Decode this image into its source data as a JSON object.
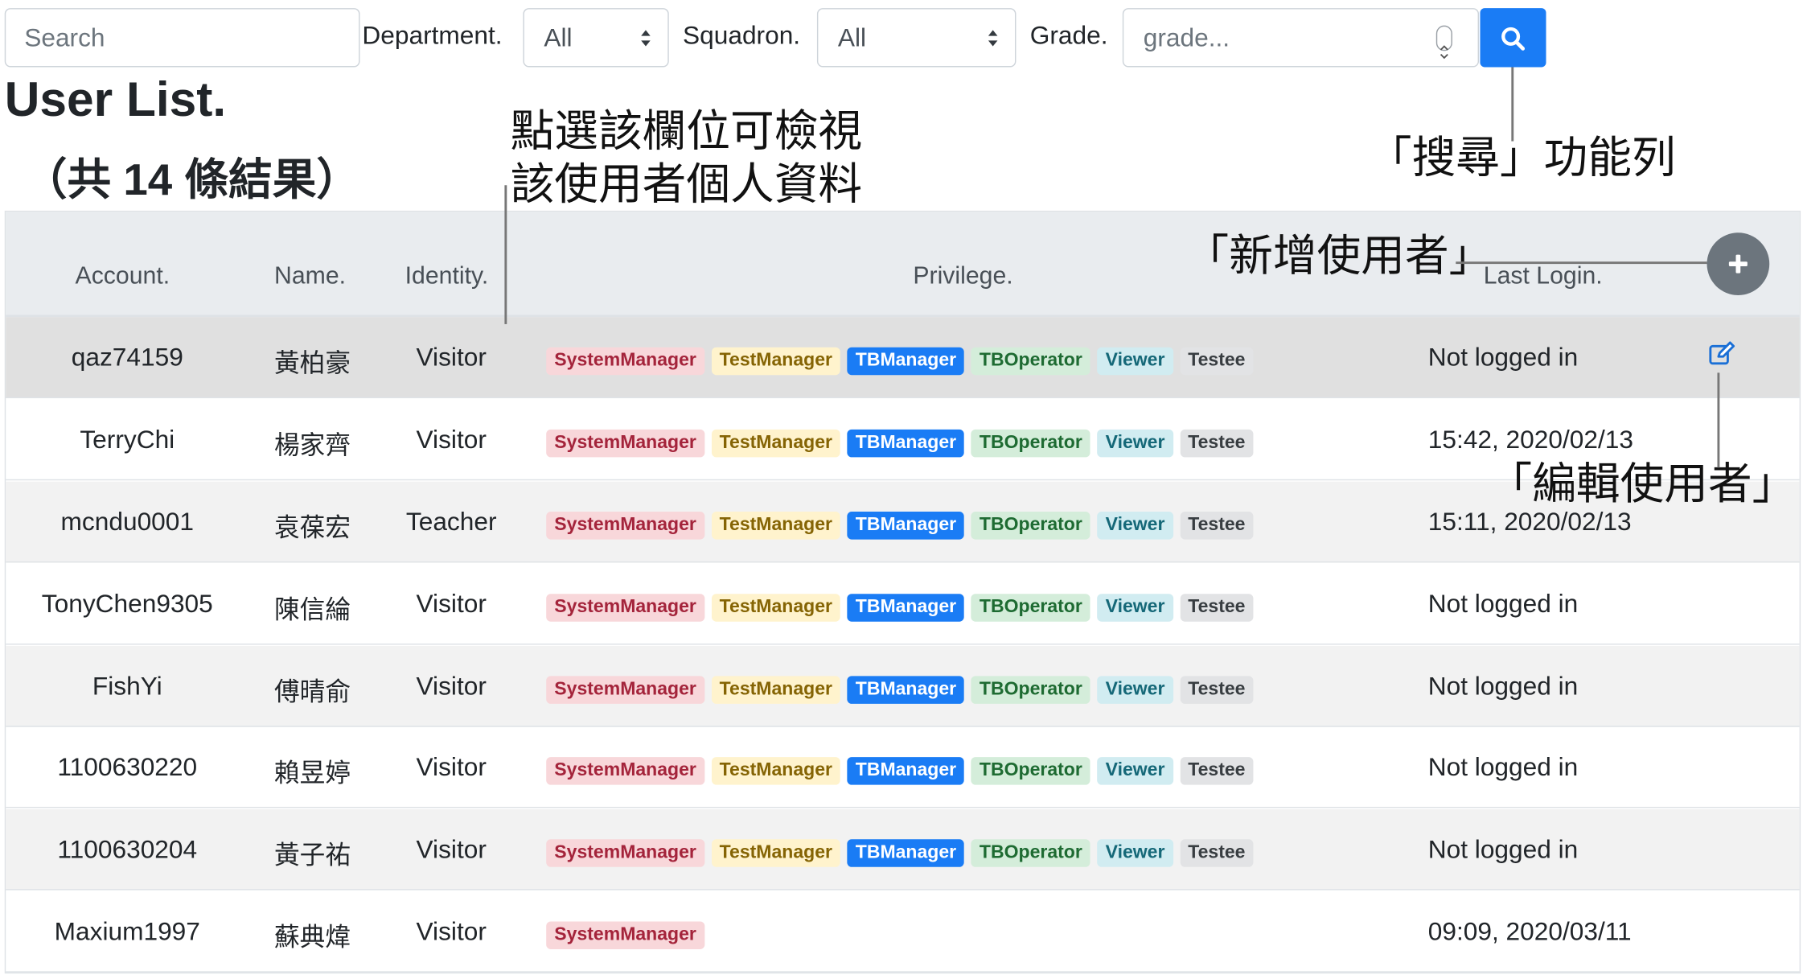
{
  "search": {
    "placeholder": "Search"
  },
  "filters": {
    "department_label": "Department.",
    "department_value": "All",
    "squadron_label": "Squadron.",
    "squadron_value": "All",
    "grade_label": "Grade.",
    "grade_placeholder": "grade..."
  },
  "icons": {
    "search_button": "search-icon",
    "add_button": "plus-icon",
    "edit": "edit-icon"
  },
  "colors": {
    "primary": "#1a7cf5",
    "add_button": "#6c757d",
    "header_bg": "#e9ecef"
  },
  "page": {
    "title": "User List.",
    "result_count": "（共 14 條結果）"
  },
  "annotations": {
    "row_click_line1": "點選該欄位可檢視",
    "row_click_line2": "該使用者個人資料",
    "search_bar": "「搜尋」功能列",
    "add_user": "「新增使用者」",
    "edit_user": "「編輯使用者」"
  },
  "table": {
    "headers": {
      "account": "Account.",
      "name": "Name.",
      "identity": "Identity.",
      "privilege": "Privilege.",
      "last_login": "Last Login."
    },
    "badge_labels": [
      "SystemManager",
      "TestManager",
      "TBManager",
      "TBOperator",
      "Viewer",
      "Testee"
    ],
    "rows": [
      {
        "account": "qaz74159",
        "name": "黃柏豪",
        "identity": "Visitor",
        "last_login": "Not logged in"
      },
      {
        "account": "TerryChi",
        "name": "楊家齊",
        "identity": "Visitor",
        "last_login": "15:42, 2020/02/13"
      },
      {
        "account": "mcndu0001",
        "name": "袁葆宏",
        "identity": "Teacher",
        "last_login": "15:11, 2020/02/13"
      },
      {
        "account": "TonyChen9305",
        "name": "陳信綸",
        "identity": "Visitor",
        "last_login": "Not logged in"
      },
      {
        "account": "FishYi",
        "name": "傅晴俞",
        "identity": "Visitor",
        "last_login": "Not logged in"
      },
      {
        "account": "1100630220",
        "name": "賴昱婷",
        "identity": "Visitor",
        "last_login": "Not logged in"
      },
      {
        "account": "1100630204",
        "name": "黃子祐",
        "identity": "Visitor",
        "last_login": "Not logged in"
      },
      {
        "account": "Maxium1997",
        "name": "蘇典煒",
        "identity": "Visitor",
        "last_login": "09:09, 2020/03/11"
      }
    ]
  }
}
